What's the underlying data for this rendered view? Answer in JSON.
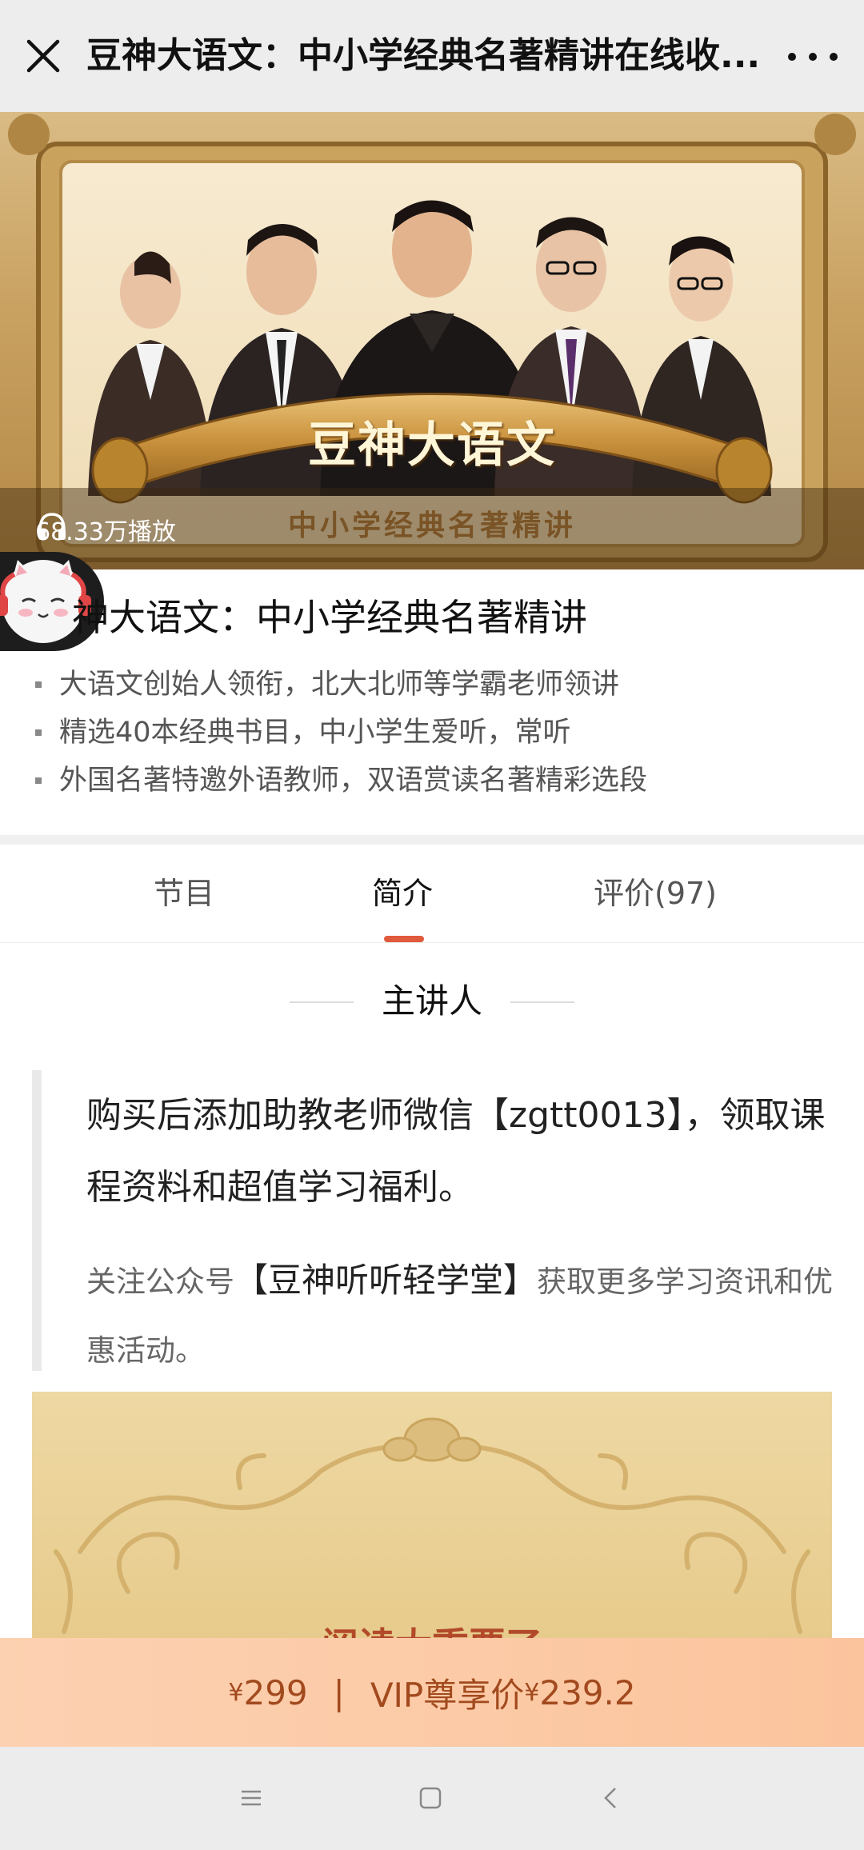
{
  "topbar": {
    "title": "豆神大语文：中小学经典名著精讲在线收...",
    "close_icon": "close-icon",
    "more_icon": "more-dots-icon"
  },
  "hero": {
    "banner_title": "豆神大语文",
    "banner_subtitle": "中小学经典名著精讲",
    "play_count": "68.33万播放"
  },
  "course": {
    "title": "神大语文：中小学经典名著精讲",
    "bullets": [
      "大语文创始人领衔，北大北师等学霸老师领讲",
      "精选40本经典书目，中小学生爱听，常听",
      "外国名著特邀外语教师，双语赏读名著精彩选段"
    ]
  },
  "tabs": [
    {
      "label": "节目"
    },
    {
      "label": "简介"
    },
    {
      "label": "评价(97)"
    }
  ],
  "section": {
    "heading": "主讲人"
  },
  "quote": {
    "p1": "购买后添加助教老师微信【zgtt0013】，领取课程资料和超值学习福利。",
    "p2_before": "关注公众号",
    "p2_highlight": "【豆神听听轻学堂】",
    "p2_after": "获取更多学习资讯和优惠活动。"
  },
  "gold_image": {
    "peek_text": "阅读太重要了"
  },
  "pricebar": {
    "currency": "¥",
    "price": "299",
    "divider": "|",
    "vip_label": "VIP尊享价",
    "vip_price": "239.2"
  },
  "colors": {
    "accent": "#e05a3c",
    "price_text": "#a24a1e",
    "price_bg": "#fcd1b1",
    "gold": "#e7cb8c"
  }
}
